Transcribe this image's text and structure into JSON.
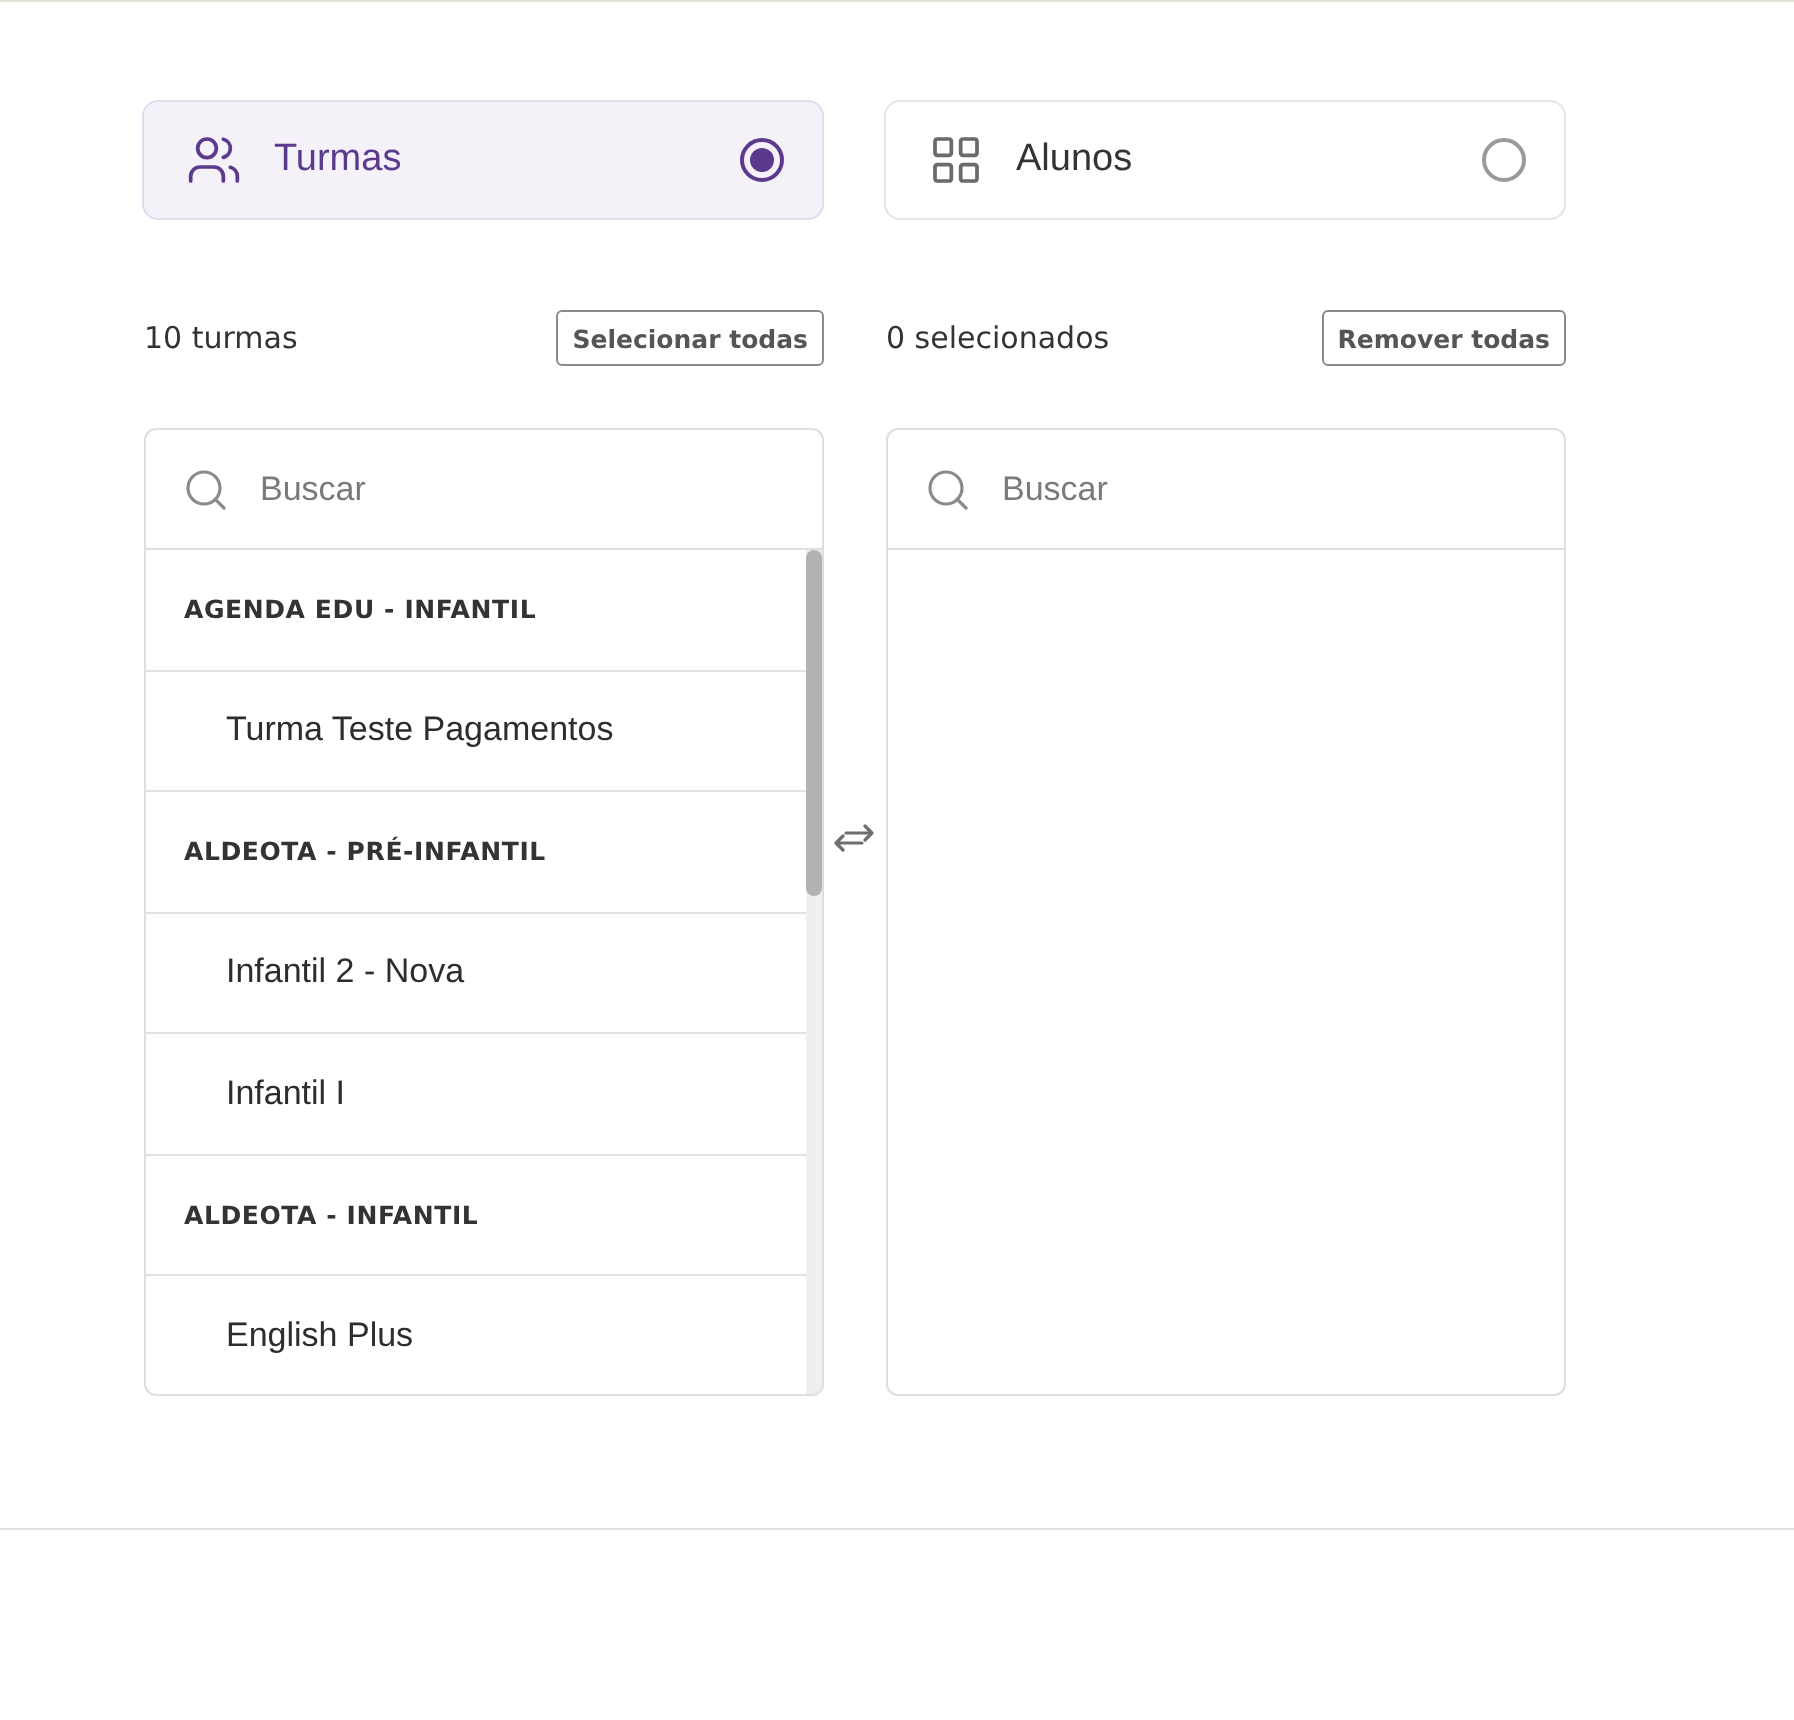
{
  "modes": [
    {
      "label": "Turmas",
      "selected": true
    },
    {
      "label": "Alunos",
      "selected": false
    }
  ],
  "source": {
    "count": "10 turmas",
    "action": "Selecionar todas",
    "search": {
      "placeholder": "Buscar"
    },
    "items": [
      {
        "kind": "group",
        "label": "AGENDA EDU - INFANTIL"
      },
      {
        "kind": "item",
        "label": "Turma Teste Pagamentos"
      },
      {
        "kind": "group",
        "label": "ALDEOTA - PRÉ-INFANTIL"
      },
      {
        "kind": "item",
        "label": "Infantil 2 - Nova"
      },
      {
        "kind": "item",
        "label": "Infantil I"
      },
      {
        "kind": "group",
        "label": "ALDEOTA - INFANTIL"
      },
      {
        "kind": "item",
        "label": "English Plus"
      }
    ]
  },
  "target": {
    "count": "0 selecionados",
    "action": "Remover todas",
    "search": {
      "placeholder": "Buscar"
    }
  }
}
